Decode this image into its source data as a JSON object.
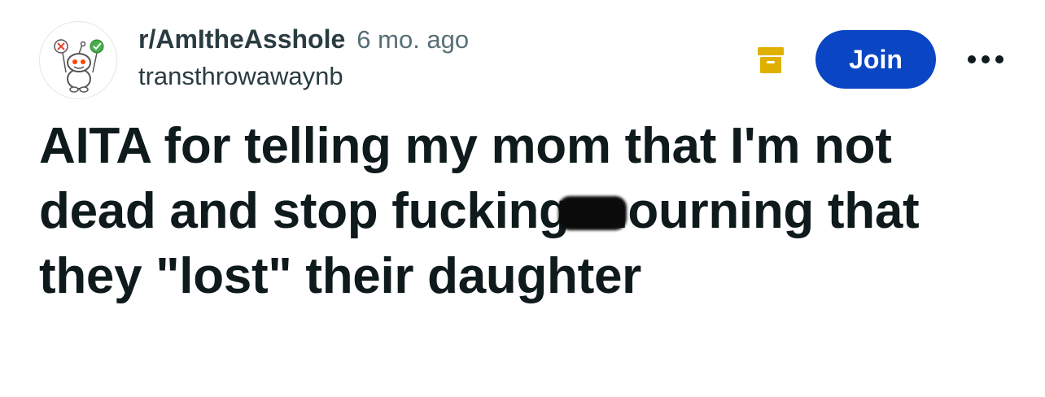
{
  "post": {
    "subreddit": "r/AmItheAsshole",
    "timestamp": "6 mo. ago",
    "username": "transthrowawaynb",
    "title": "AITA for telling my mom that I'm not dead and stop fucking mourning that they \"lost\" their daughter"
  },
  "actions": {
    "join_label": "Join"
  },
  "icons": {
    "avatar": "subreddit-avatar-icon",
    "archive": "archive-icon",
    "overflow": "more-options-icon"
  },
  "colors": {
    "join_button": "#0a45c4",
    "archive_icon": "#e0b000",
    "text_primary": "#0f1a1c",
    "text_secondary": "#576f76"
  }
}
